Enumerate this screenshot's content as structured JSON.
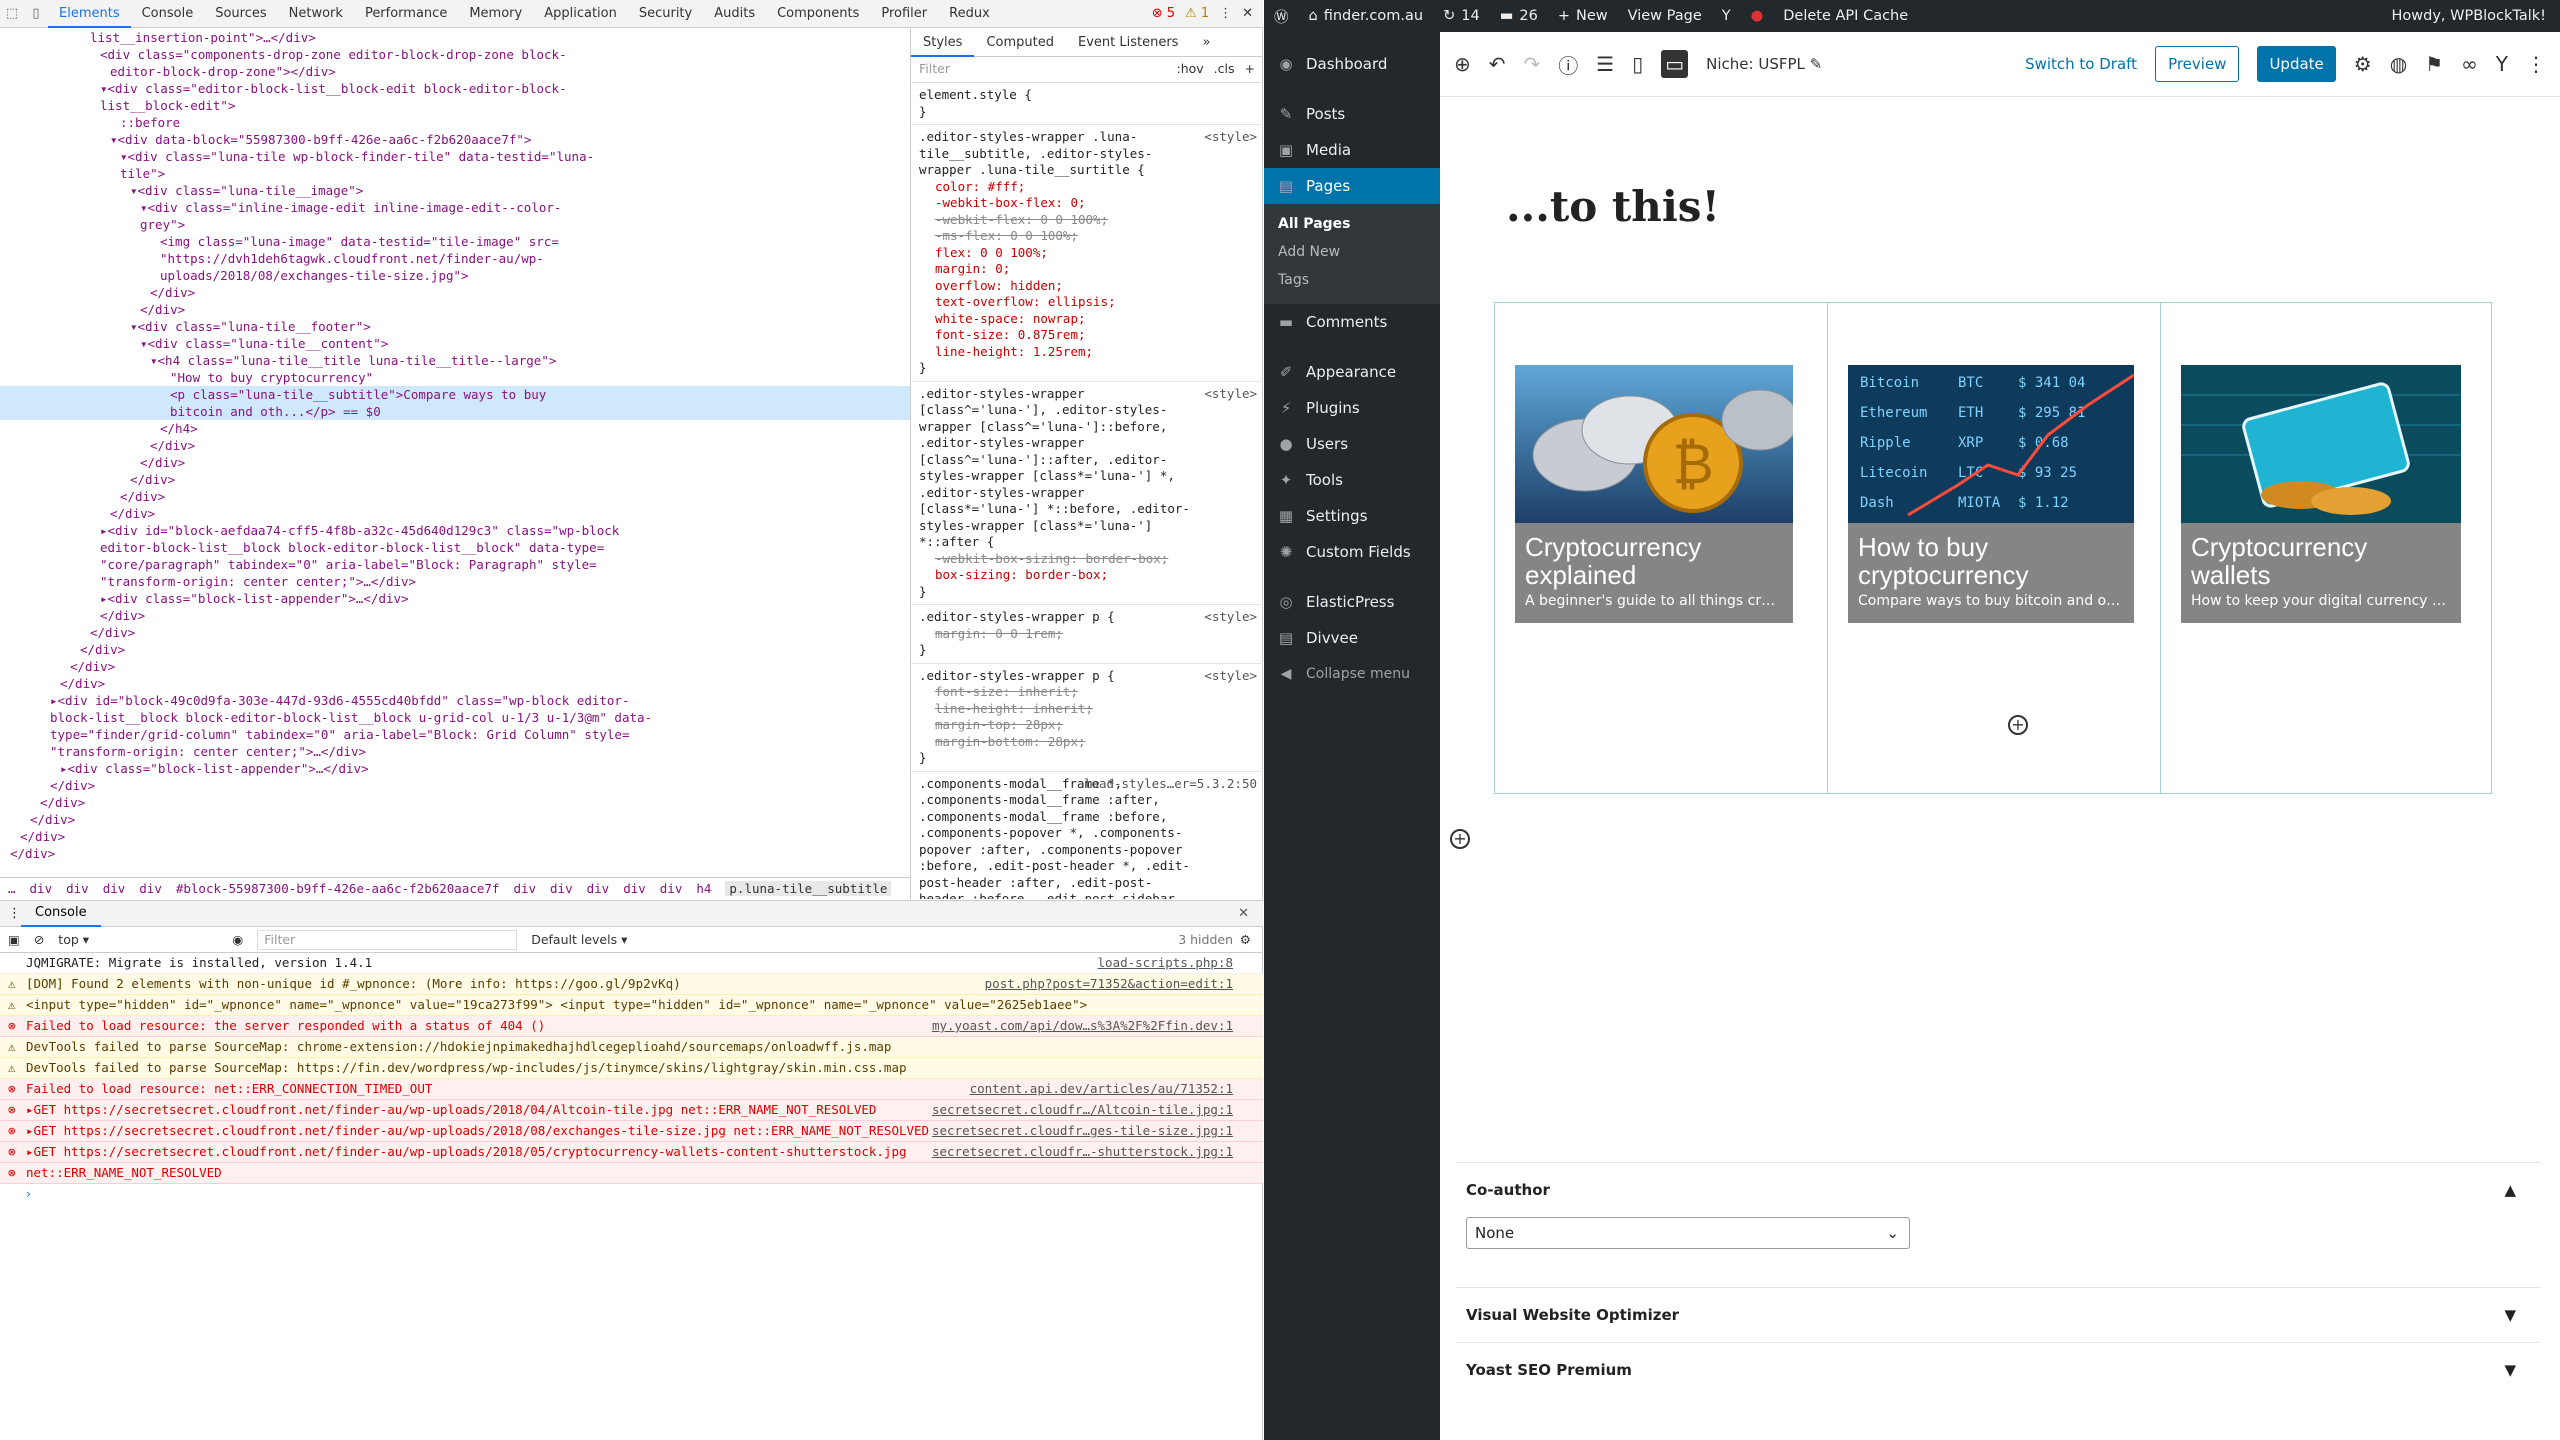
{
  "devtools": {
    "tabs": [
      "Elements",
      "Console",
      "Sources",
      "Network",
      "Performance",
      "Memory",
      "Application",
      "Security",
      "Audits",
      "Components",
      "Profiler",
      "Redux"
    ],
    "error_count": "5",
    "warning_count": "1",
    "dom_lines": [
      {
        "indent": 24,
        "text": "list__insertion-point\">…</div>"
      },
      {
        "indent": 25,
        "text": "<div class=\"components-drop-zone editor-block-drop-zone block-"
      },
      {
        "indent": 26,
        "text": "editor-block-drop-zone\"></div>"
      },
      {
        "indent": 25,
        "text": "▾<div class=\"editor-block-list__block-edit block-editor-block-"
      },
      {
        "indent": 25,
        "text": "list__block-edit\">"
      },
      {
        "indent": 27,
        "text": "::before"
      },
      {
        "indent": 26,
        "text": "▾<div data-block=\"55987300-b9ff-426e-aa6c-f2b620aace7f\">"
      },
      {
        "indent": 27,
        "text": "▾<div class=\"luna-tile wp-block-finder-tile\" data-testid=\"luna-"
      },
      {
        "indent": 27,
        "text": "tile\">"
      },
      {
        "indent": 28,
        "text": "▾<div class=\"luna-tile__image\">"
      },
      {
        "indent": 29,
        "text": "▾<div class=\"inline-image-edit inline-image-edit--color-"
      },
      {
        "indent": 29,
        "text": "grey\">"
      },
      {
        "indent": 31,
        "text": "<img class=\"luna-image\" data-testid=\"tile-image\" src="
      },
      {
        "indent": 31,
        "text": "\"https://dvh1deh6tagwk.cloudfront.net/finder-au/wp-"
      },
      {
        "indent": 31,
        "text": "uploads/2018/08/exchanges-tile-size.jpg\">"
      },
      {
        "indent": 30,
        "text": "</div>"
      },
      {
        "indent": 29,
        "text": "</div>"
      },
      {
        "indent": 28,
        "text": "▾<div class=\"luna-tile__footer\">"
      },
      {
        "indent": 29,
        "text": "▾<div class=\"luna-tile__content\">"
      },
      {
        "indent": 30,
        "text": "▾<h4 class=\"luna-tile__title luna-tile__title--large\">"
      },
      {
        "indent": 32,
        "text": "\"How to buy cryptocurrency\""
      },
      {
        "indent": 32,
        "text": "<p class=\"luna-tile__subtitle\">Compare ways to buy",
        "sel": true
      },
      {
        "indent": 32,
        "text": "bitcoin and oth...</p> == $0",
        "sel": true
      },
      {
        "indent": 31,
        "text": "</h4>"
      },
      {
        "indent": 30,
        "text": "</div>"
      },
      {
        "indent": 29,
        "text": "</div>"
      },
      {
        "indent": 28,
        "text": "</div>"
      },
      {
        "indent": 27,
        "text": "</div>"
      },
      {
        "indent": 26,
        "text": "</div>"
      },
      {
        "indent": 25,
        "text": "▸<div id=\"block-aefdaa74-cff5-4f8b-a32c-45d640d129c3\" class=\"wp-block"
      },
      {
        "indent": 25,
        "text": "editor-block-list__block block-editor-block-list__block\" data-type="
      },
      {
        "indent": 25,
        "text": "\"core/paragraph\" tabindex=\"0\" aria-label=\"Block: Paragraph\" style="
      },
      {
        "indent": 25,
        "text": "\"transform-origin: center center;\">…</div>"
      },
      {
        "indent": 25,
        "text": "▸<div class=\"block-list-appender\">…</div>"
      },
      {
        "indent": 25,
        "text": "</div>"
      },
      {
        "indent": 24,
        "text": "</div>"
      },
      {
        "indent": 23,
        "text": "</div>"
      },
      {
        "indent": 22,
        "text": "</div>"
      },
      {
        "indent": 21,
        "text": "</div>"
      },
      {
        "indent": 20,
        "text": "▸<div id=\"block-49c0d9fa-303e-447d-93d6-4555cd40bfdd\" class=\"wp-block editor-"
      },
      {
        "indent": 20,
        "text": "block-list__block block-editor-block-list__block u-grid-col u-1/3 u-1/3@m\" data-"
      },
      {
        "indent": 20,
        "text": "type=\"finder/grid-column\" tabindex=\"0\" aria-label=\"Block: Grid Column\" style="
      },
      {
        "indent": 20,
        "text": "\"transform-origin: center center;\">…</div>"
      },
      {
        "indent": 21,
        "text": "▸<div class=\"block-list-appender\">…</div>"
      },
      {
        "indent": 20,
        "text": "</div>"
      },
      {
        "indent": 19,
        "text": "</div>"
      },
      {
        "indent": 18,
        "text": "</div>"
      },
      {
        "indent": 17,
        "text": "</div>"
      },
      {
        "indent": 16,
        "text": "</div>"
      }
    ],
    "breadcrumb": [
      "…",
      "div",
      "div",
      "div",
      "div",
      "#block-55987300-b9ff-426e-aa6c-f2b620aace7f",
      "div",
      "div",
      "div",
      "div",
      "div",
      "h4",
      "p.luna-tile__subtitle"
    ],
    "styles_tabs": [
      "Styles",
      "Computed",
      "Event Listeners",
      "»"
    ],
    "styles_filter_placeholder": "Filter",
    "styles_hov": ":hov",
    "styles_cls": ".cls",
    "style_rules": [
      {
        "sel": "element.style {",
        "src": "",
        "props": []
      },
      {
        "sel": ".editor-styles-wrapper .luna-tile__subtitle, .editor-styles-wrapper .luna-tile__surtitle {",
        "src": "<style>",
        "props": [
          {
            "t": "color: #fff;",
            "x": false
          },
          {
            "t": "-webkit-box-flex: 0;",
            "x": false
          },
          {
            "t": "-webkit-flex: 0 0 100%;",
            "x": true
          },
          {
            "t": "-ms-flex: 0 0 100%;",
            "x": true
          },
          {
            "t": "flex: 0 0 100%;",
            "x": false
          },
          {
            "t": "margin: 0;",
            "x": false
          },
          {
            "t": "overflow: hidden;",
            "x": false
          },
          {
            "t": "text-overflow: ellipsis;",
            "x": false
          },
          {
            "t": "white-space: nowrap;",
            "x": false
          },
          {
            "t": "font-size: 0.875rem;",
            "x": false
          },
          {
            "t": "line-height: 1.25rem;",
            "x": false
          }
        ]
      },
      {
        "sel": ".editor-styles-wrapper [class^='luna-'], .editor-styles-wrapper [class^='luna-']::before, .editor-styles-wrapper [class^='luna-']::after, .editor-styles-wrapper [class*='luna-'] *, .editor-styles-wrapper [class*='luna-'] *::before, .editor-styles-wrapper [class*='luna-'] *::after {",
        "src": "<style>",
        "props": [
          {
            "t": "-webkit-box-sizing: border-box;",
            "x": true
          },
          {
            "t": "box-sizing: border-box;",
            "x": false
          }
        ]
      },
      {
        "sel": ".editor-styles-wrapper p {",
        "src": "<style>",
        "props": [
          {
            "t": "margin: 0 0 1rem;",
            "x": true
          }
        ]
      },
      {
        "sel": ".editor-styles-wrapper p {",
        "src": "<style>",
        "props": [
          {
            "t": "font-size: inherit;",
            "x": true
          },
          {
            "t": "line-height: inherit;",
            "x": true
          },
          {
            "t": "margin-top: 28px;",
            "x": true
          },
          {
            "t": "margin-bottom: 28px;",
            "x": true
          }
        ]
      },
      {
        "sel": ".components-modal__frame *, .components-modal__frame :after, .components-modal__frame :before, .components-popover *, .components-popover :after, .components-popover :before, .edit-post-header *, .edit-post-header :after, .edit-post-header :before, .edit-post-sidebar *, .edit-post-sidebar :after, .edit-post-sidebar :before, .edit-post-text-editor *, .edit-post-text-editor :after, .edit-post-text-editor :before, .edit-post-visual-editor *, .edit-post-visual-editor :after, .edit-post-visual-editor :before, .editor-post-publish-panel",
        "src": "load-styles…er=5.3.2:50",
        "props": []
      }
    ],
    "console_tab": "Console",
    "console_context": "top",
    "console_filter_placeholder": "Filter",
    "console_levels": "Default levels ▾",
    "console_hidden": "3 hidden",
    "console_lines": [
      {
        "type": "info",
        "text": "JQMIGRATE: Migrate is installed, version 1.4.1",
        "src": "load-scripts.php:8"
      },
      {
        "type": "warn",
        "text": "[DOM] Found 2 elements with non-unique id #_wpnonce: (More info: https://goo.gl/9p2vKq)",
        "src": "post.php?post=71352&action=edit:1"
      },
      {
        "type": "warn",
        "text": "<input type=\"hidden\" id=\"_wpnonce\" name=\"_wpnonce\" value=\"19ca273f99\">   <input type=\"hidden\" id=\"_wpnonce\" name=\"_wpnonce\" value=\"2625eb1aee\">",
        "src": ""
      },
      {
        "type": "err",
        "text": "Failed to load resource: the server responded with a status of 404 ()",
        "src": "my.yoast.com/api/dow…s%3A%2F%2Ffin.dev:1"
      },
      {
        "type": "warn",
        "text": "DevTools failed to parse SourceMap: chrome-extension://hdokiejnpimakedhajhdlcegeplioahd/sourcemaps/onloadwff.js.map",
        "src": ""
      },
      {
        "type": "warn",
        "text": "DevTools failed to parse SourceMap: https://fin.dev/wordpress/wp-includes/js/tinymce/skins/lightgray/skin.min.css.map",
        "src": ""
      },
      {
        "type": "err",
        "text": "Failed to load resource: net::ERR_CONNECTION_TIMED_OUT",
        "src": "content.api.dev/articles/au/71352:1"
      },
      {
        "type": "err",
        "text": "▸GET https://secretsecret.cloudfront.net/finder-au/wp-uploads/2018/04/Altcoin-tile.jpg net::ERR_NAME_NOT_RESOLVED",
        "src": "secretsecret.cloudfr…/Altcoin-tile.jpg:1"
      },
      {
        "type": "err",
        "text": "▸GET https://secretsecret.cloudfront.net/finder-au/wp-uploads/2018/08/exchanges-tile-size.jpg net::ERR_NAME_NOT_RESOLVED",
        "src": "secretsecret.cloudfr…ges-tile-size.jpg:1"
      },
      {
        "type": "err",
        "text": "▸GET https://secretsecret.cloudfront.net/finder-au/wp-uploads/2018/05/cryptocurrency-wallets-content-shutterstock.jpg",
        "src": "secretsecret.cloudfr…-shutterstock.jpg:1"
      },
      {
        "type": "err",
        "text": "net::ERR_NAME_NOT_RESOLVED",
        "src": ""
      }
    ],
    "console_prompt": "›"
  },
  "adminbar": {
    "site": "finder.com.au",
    "updates": "14",
    "comments": "26",
    "new": "New",
    "view": "View Page",
    "cache": "Delete API Cache",
    "howdy": "Howdy, WPBlockTalk!"
  },
  "sidebar": {
    "items": [
      {
        "label": "Dashboard",
        "icon": "dashboard-icon",
        "glyph": "◉"
      },
      {
        "label": "Posts",
        "icon": "pin-icon",
        "glyph": "✎"
      },
      {
        "label": "Media",
        "icon": "media-icon",
        "glyph": "▣"
      },
      {
        "label": "Pages",
        "icon": "page-icon",
        "glyph": "▤"
      }
    ],
    "sub": [
      "All Pages",
      "Add New",
      "Tags"
    ],
    "items2": [
      {
        "label": "Comments",
        "icon": "comments-icon",
        "glyph": "▬"
      },
      {
        "label": "Appearance",
        "icon": "brush-icon",
        "glyph": "✐"
      },
      {
        "label": "Plugins",
        "icon": "plugin-icon",
        "glyph": "⚡"
      },
      {
        "label": "Users",
        "icon": "user-icon",
        "glyph": "●"
      },
      {
        "label": "Tools",
        "icon": "wrench-icon",
        "glyph": "✦"
      },
      {
        "label": "Settings",
        "icon": "settings-icon",
        "glyph": "▦"
      },
      {
        "label": "Custom Fields",
        "icon": "gear-icon",
        "glyph": "✺"
      },
      {
        "label": "ElasticPress",
        "icon": "elasticpress-icon",
        "glyph": "◎"
      },
      {
        "label": "Divvee",
        "icon": "divvee-icon",
        "glyph": "▤"
      }
    ],
    "collapse": "Collapse menu"
  },
  "editor": {
    "niche": "Niche: USFPL",
    "switch_draft": "Switch to Draft",
    "preview": "Preview",
    "update": "Update",
    "page_title": "...to this!",
    "cards": [
      {
        "title": "Cryptocurrency explained",
        "subtitle": "A beginner's guide to all things crypto"
      },
      {
        "title": "How to buy cryptocurrency",
        "subtitle": "Compare ways to buy bitcoin and oth..."
      },
      {
        "title": "Cryptocurrency wallets",
        "subtitle": "How to keep your digital currency safe"
      }
    ],
    "meta": {
      "coauthor": "Co-author",
      "coauthor_value": "None",
      "vwo": "Visual Website Optimizer",
      "yoast": "Yoast SEO Premium"
    }
  },
  "colors": {
    "accent": "#0073aa",
    "admin_dark": "#23282d",
    "card_grey": "#858585"
  }
}
